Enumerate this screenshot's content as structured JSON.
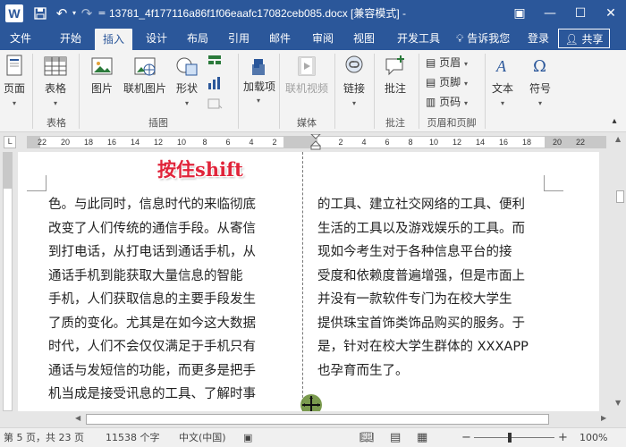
{
  "titlebar": {
    "app_logo": "W",
    "save_icon": "save-icon",
    "undo_glyph": "↶",
    "redo_glyph": "↷",
    "customize_glyph": "=",
    "title": "13781_4f177116a86f1f06eaafc17082ceb085.docx [兼容模式] -",
    "ribbon_display_glyph": "▣",
    "minimize_glyph": "—",
    "maximize_glyph": "☐",
    "close_glyph": "✕"
  },
  "tabs": {
    "items": [
      {
        "label": "文件"
      },
      {
        "label": "开始"
      },
      {
        "label": "插入"
      },
      {
        "label": "设计"
      },
      {
        "label": "布局"
      },
      {
        "label": "引用"
      },
      {
        "label": "邮件"
      },
      {
        "label": "审阅"
      },
      {
        "label": "视图"
      },
      {
        "label": "开发工具"
      }
    ],
    "active": "插入",
    "tell_me": "告诉我您",
    "sign_in": "登录",
    "share": "共享"
  },
  "ribbon": {
    "pages": {
      "label": "页面"
    },
    "table": {
      "label": "表格"
    },
    "picture": {
      "label": "图片"
    },
    "online_picture": {
      "label": "联机图片"
    },
    "shapes": {
      "label": "形状"
    },
    "addins": {
      "label": "加载项"
    },
    "online_video": {
      "label": "联机视频"
    },
    "link": {
      "label": "链接"
    },
    "comment": {
      "label": "批注"
    },
    "header": {
      "label": "页眉"
    },
    "footer": {
      "label": "页脚"
    },
    "page_number": {
      "label": "页码"
    },
    "text": {
      "label": "文本"
    },
    "symbol": {
      "label": "符号"
    },
    "groups": {
      "tables": "表格",
      "illustrations": "插图",
      "media": "媒体",
      "comments": "批注",
      "header_footer": "页眉和页脚"
    }
  },
  "ruler": {
    "tab_selector": "L",
    "ticks": [
      {
        "label": "22",
        "pos": 16
      },
      {
        "label": "20",
        "pos": 42
      },
      {
        "label": "18",
        "pos": 68
      },
      {
        "label": "16",
        "pos": 94
      },
      {
        "label": "14",
        "pos": 120
      },
      {
        "label": "12",
        "pos": 146
      },
      {
        "label": "10",
        "pos": 172
      },
      {
        "label": "8",
        "pos": 198
      },
      {
        "label": "6",
        "pos": 224
      },
      {
        "label": "4",
        "pos": 250
      },
      {
        "label": "2",
        "pos": 276
      },
      {
        "label": "2",
        "pos": 350
      },
      {
        "label": "4",
        "pos": 376
      },
      {
        "label": "6",
        "pos": 402
      },
      {
        "label": "8",
        "pos": 428
      },
      {
        "label": "10",
        "pos": 454
      },
      {
        "label": "12",
        "pos": 480
      },
      {
        "label": "14",
        "pos": 506
      },
      {
        "label": "16",
        "pos": 532
      },
      {
        "label": "18",
        "pos": 558
      },
      {
        "label": "20",
        "pos": 592
      },
      {
        "label": "22",
        "pos": 618
      }
    ]
  },
  "document": {
    "overlay": "按住shift",
    "left_column": [
      "色。与此同时，信息时代的来临彻底",
      "改变了人们传统的通信手段。从寄信",
      "到打电话，从打电话到通话手机，从",
      "通话手机到能获取大量信息的智能",
      "手机，人们获取信息的主要手段发生",
      "了质的变化。尤其是在如今这大数据",
      "时代，人们不会仅仅满足于手机只有",
      "通话与发短信的功能，而更多是把手",
      "机当成是接受讯息的工具、了解时事"
    ],
    "right_column": [
      "的工具、建立社交网络的工具、便利",
      "生活的工具以及游戏娱乐的工具。而",
      "现如今考生对于各种信息平台的接",
      "受度和依赖度普遍增强，但是市面上",
      "并没有一款软件专门为在校大学生",
      "提供珠宝首饰类饰品购买的服务。于",
      "是，针对在校大学生群体的 XXXAPP",
      "也孕育而生了。"
    ]
  },
  "statusbar": {
    "page": "第 5 页，共 23 页",
    "words": "11538 个字",
    "language": "中文(中国)",
    "zoom_minus": "−",
    "zoom_plus": "+",
    "zoom": "100%"
  },
  "colors": {
    "brand": "#2b579a",
    "overlay_text": "#e0243a"
  }
}
